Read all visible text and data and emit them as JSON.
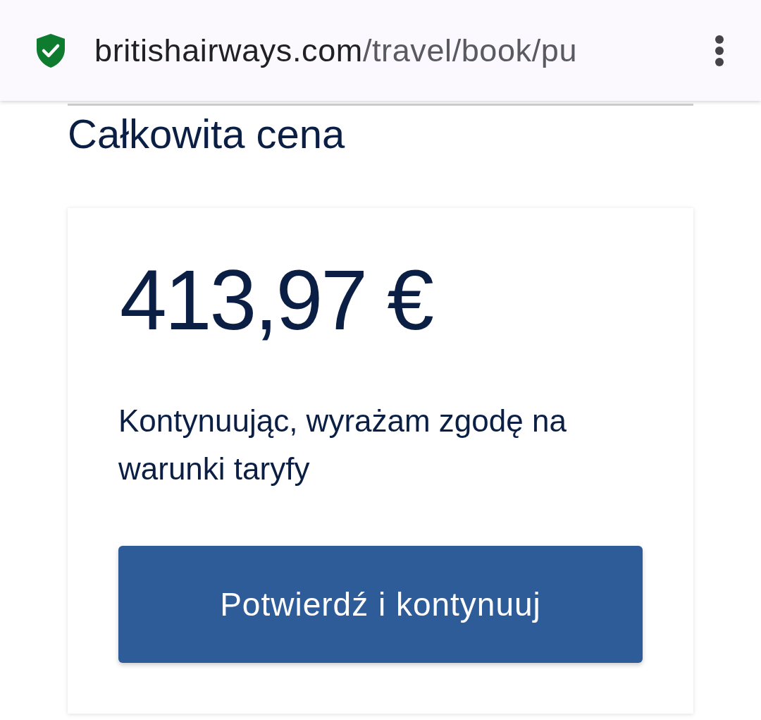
{
  "browser_bar": {
    "secure": true,
    "url_host": "britishairways.com",
    "url_path": "/travel/book/pu"
  },
  "section": {
    "heading": "Całkowita cena"
  },
  "price_card": {
    "amount": "413,97 €",
    "consent_text": "Kontynuując, wyrażam zgodę na warunki taryfy",
    "button": "Potwierdź i kontynuuj"
  }
}
